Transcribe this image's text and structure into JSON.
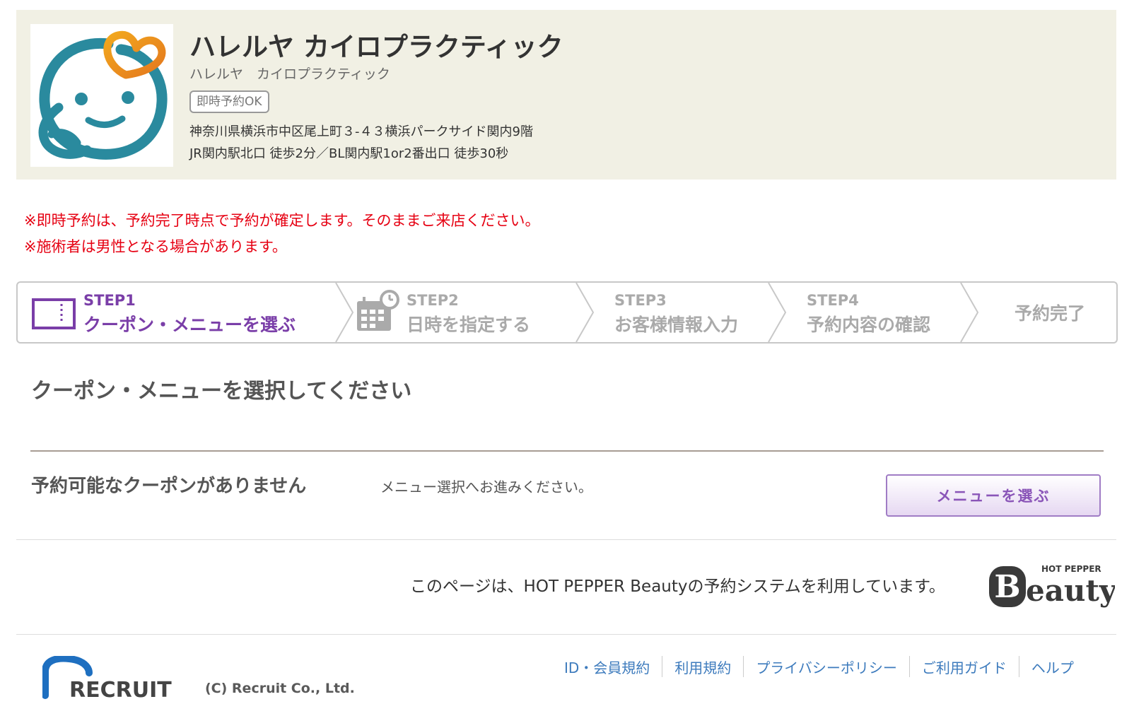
{
  "shop": {
    "name": "ハレルヤ カイロプラクティック",
    "name_kana": "ハレルヤ　カイロプラクティック",
    "badge": "即時予約OK",
    "address": "神奈川県横浜市中区尾上町３-４３横浜パークサイド関内9階",
    "access": "JR関内駅北口 徒歩2分／BL関内駅1or2番出口 徒歩30秒"
  },
  "notices": [
    "※即時予約は、予約完了時点で予約が確定します。そのままご来店ください。",
    "※施術者は男性となる場合があります。"
  ],
  "steps": [
    {
      "num": "STEP1",
      "label": "クーポン・メニューを選ぶ",
      "icon": "coupon-card-icon"
    },
    {
      "num": "STEP2",
      "label": "日時を指定する",
      "icon": "calendar-clock-icon"
    },
    {
      "num": "STEP3",
      "label": "お客様情報入力"
    },
    {
      "num": "STEP4",
      "label": "予約内容の確認"
    },
    {
      "label": "予約完了"
    }
  ],
  "section": {
    "title": "クーポン・メニューを選択してください",
    "no_coupon": "予約可能なクーポンがありません",
    "message": "メニュー選択へお進みください。",
    "button": "メニューを選ぶ"
  },
  "powered_by": "このページは、HOT PEPPER Beautyの予約システムを利用しています。",
  "hpb_logo": {
    "small": "HOT PEPPER",
    "main": "eauty"
  },
  "footer": {
    "recruit_logo": "RECRUIT",
    "copyright": "(C) Recruit Co., Ltd.",
    "links": [
      "ID・会員規約",
      "利用規約",
      "プライバシーポリシー",
      "ご利用ガイド",
      "ヘルプ"
    ]
  },
  "colors": {
    "header_bg": "#f1f0e4",
    "notice": "#e60012",
    "active_step": "#7a3ea8",
    "inactive_step": "#aaaaaa",
    "link": "#3d7bbd",
    "logo_teal": "#2a8a9e",
    "logo_orange": "#e8951e"
  }
}
